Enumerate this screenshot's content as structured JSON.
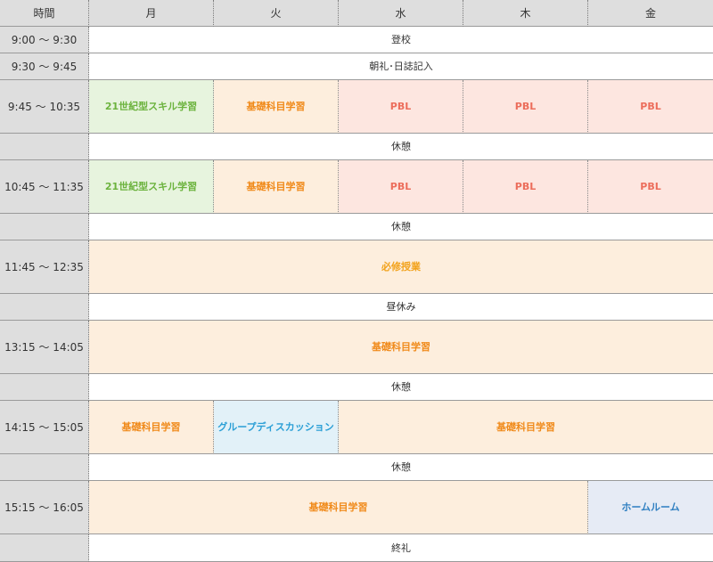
{
  "header": {
    "time": "時間",
    "days": [
      "月",
      "火",
      "水",
      "木",
      "金"
    ]
  },
  "rows": [
    {
      "time": "9:00 ～ 9:30",
      "cells": [
        {
          "text": "登校",
          "type": "plain",
          "span": 5
        }
      ]
    },
    {
      "time": "9:30 ～ 9:45",
      "cells": [
        {
          "text": "朝礼･日誌記入",
          "type": "plain",
          "span": 5
        }
      ]
    },
    {
      "time": "9:45 ～ 10:35",
      "cells": [
        {
          "text": "21世紀型スキル学習",
          "type": "skill",
          "span": 1
        },
        {
          "text": "基礎科目学習",
          "type": "kiso",
          "span": 1
        },
        {
          "text": "PBL",
          "type": "pbl",
          "span": 1
        },
        {
          "text": "PBL",
          "type": "pbl",
          "span": 1
        },
        {
          "text": "PBL",
          "type": "pbl",
          "span": 1
        }
      ]
    },
    {
      "time": "",
      "cells": [
        {
          "text": "休憩",
          "type": "plain",
          "span": 5
        }
      ]
    },
    {
      "time": "10:45 ～ 11:35",
      "cells": [
        {
          "text": "21世紀型スキル学習",
          "type": "skill",
          "span": 1
        },
        {
          "text": "基礎科目学習",
          "type": "kiso",
          "span": 1
        },
        {
          "text": "PBL",
          "type": "pbl",
          "span": 1
        },
        {
          "text": "PBL",
          "type": "pbl",
          "span": 1
        },
        {
          "text": "PBL",
          "type": "pbl",
          "span": 1
        }
      ]
    },
    {
      "time": "",
      "cells": [
        {
          "text": "休憩",
          "type": "plain",
          "span": 5
        }
      ]
    },
    {
      "time": "11:45 ～ 12:35",
      "cells": [
        {
          "text": "必修授業",
          "type": "hisshu",
          "span": 5
        }
      ]
    },
    {
      "time": "",
      "cells": [
        {
          "text": "昼休み",
          "type": "plain",
          "span": 5
        }
      ]
    },
    {
      "time": "13:15 ～ 14:05",
      "cells": [
        {
          "text": "基礎科目学習",
          "type": "kiso",
          "span": 5
        }
      ]
    },
    {
      "time": "",
      "cells": [
        {
          "text": "休憩",
          "type": "plain",
          "span": 5
        }
      ]
    },
    {
      "time": "14:15 ～ 15:05",
      "cells": [
        {
          "text": "基礎科目学習",
          "type": "kiso",
          "span": 1
        },
        {
          "text": "グループディスカッション",
          "type": "gd",
          "span": 1
        },
        {
          "text": "基礎科目学習",
          "type": "kiso",
          "span": 3
        }
      ]
    },
    {
      "time": "",
      "cells": [
        {
          "text": "休憩",
          "type": "plain",
          "span": 5
        }
      ]
    },
    {
      "time": "15:15 ～ 16:05",
      "cells": [
        {
          "text": "基礎科目学習",
          "type": "kiso",
          "span": 4
        },
        {
          "text": "ホームルーム",
          "type": "hr",
          "span": 1
        }
      ]
    },
    {
      "time": "",
      "cells": [
        {
          "text": "終礼",
          "type": "plain",
          "span": 5
        }
      ]
    }
  ]
}
